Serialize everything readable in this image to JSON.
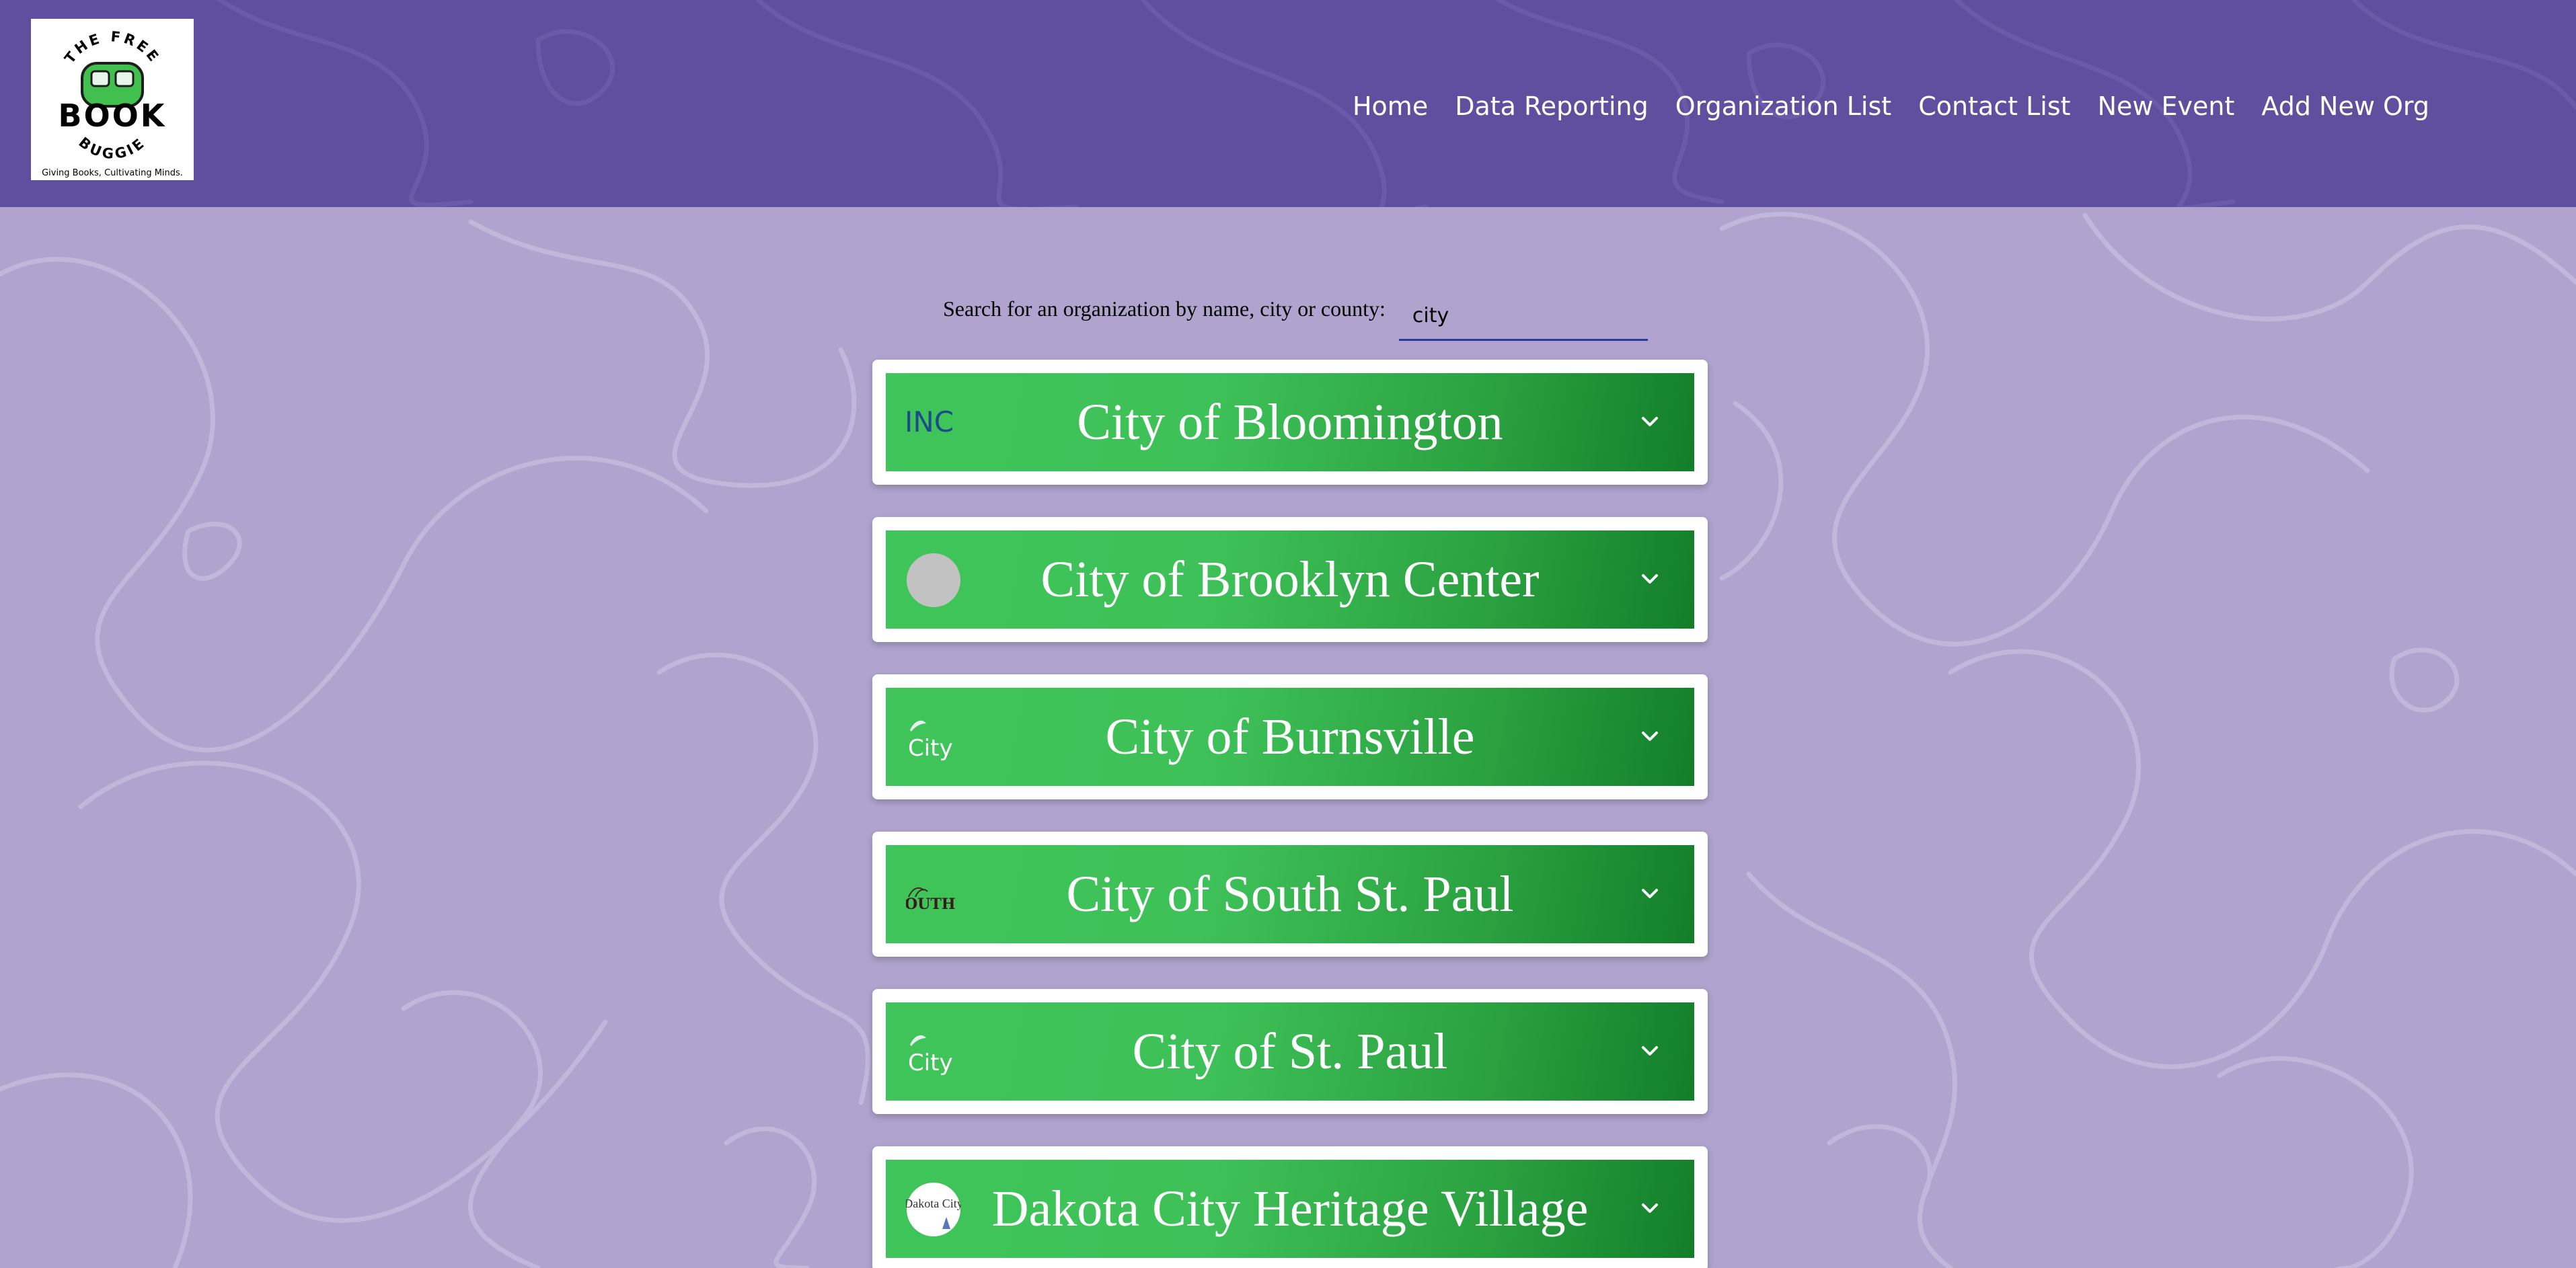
{
  "header": {
    "logo": {
      "top_text": "THE FREE",
      "main_text": "BOOK",
      "bottom_text": "BUGGIE",
      "tagline": "Giving Books, Cultivating Minds."
    },
    "nav": [
      {
        "label": "Home"
      },
      {
        "label": "Data Reporting"
      },
      {
        "label": "Organization List"
      },
      {
        "label": "Contact List"
      },
      {
        "label": "New Event"
      },
      {
        "label": "Add New Org"
      }
    ]
  },
  "search": {
    "label": "Search for an organization by name, city or county:",
    "value": "city"
  },
  "organizations": [
    {
      "name": "City of Bloomington",
      "logo_text": "INC"
    },
    {
      "name": "City of Brooklyn Center"
    },
    {
      "name": "City of Burnsville",
      "logo_text": "City"
    },
    {
      "name": "City of South St. Paul",
      "logo_text": "OUTH S"
    },
    {
      "name": "City of St. Paul",
      "logo_text": "City"
    },
    {
      "name": "Dakota City Heritage Village",
      "logo_text": "Dakota City"
    }
  ],
  "colors": {
    "header_bg": "#5f4f9f",
    "page_bg": "#b0a4ce",
    "card_bar_light": "#3fc55a",
    "card_bar_dark": "#137e2a",
    "search_underline": "#2c3a9a"
  },
  "icons": {
    "chevron": "chevron-down-icon"
  }
}
